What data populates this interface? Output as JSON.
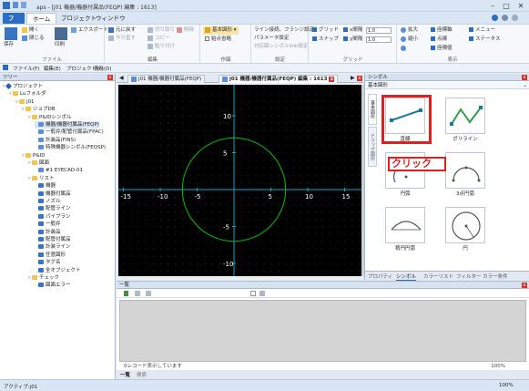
{
  "window": {
    "title": "aps - [j01 機器/機器付属品(FEQP) 編集 : 1613]",
    "min": "–",
    "max": "□",
    "close": "✕"
  },
  "tabs": {
    "file": "ファイル",
    "home": "ホーム",
    "project": "プロジェクト",
    "window": "ウィンドウ"
  },
  "ribbon": {
    "file_group": {
      "save": "保存",
      "open": "開く",
      "close": "閉じる",
      "print": "印刷",
      "export": "エクスポート",
      "label": "ファイル"
    },
    "edit_group": {
      "undo": "元に戻す",
      "redo": "やり直す",
      "cut": "切り取り",
      "delete": "削除",
      "copy": "コピー",
      "paste": "貼り付け",
      "label": "編集"
    },
    "draw_group": {
      "basic_shape": "基本図形",
      "midpoint": "始点省略",
      "label": "作図"
    },
    "settings_group": {
      "line_conn": "ライン接続、フランジ設定",
      "param": "パラメータ設定",
      "symbol_link": "対応図シンボルlink設定",
      "label": "設定"
    },
    "grid_group": {
      "grid": "グリッド",
      "snap": "スナップ",
      "x_spacing": "x間隔",
      "y_spacing": "y間隔",
      "x_value": "1.0",
      "y_value": "1.0",
      "label": "グリッド"
    },
    "view_group": {
      "zoom_in": "拡大",
      "zoom_out": "縮小",
      "coord_sys": "座標軸",
      "point": "点線",
      "coord_val": "座標値",
      "menu": "メニュー",
      "status": "ステータス",
      "label": "表示"
    }
  },
  "menubar2": {
    "file": "ファイル(F)",
    "edit": "編集(E)",
    "project": "プロジェクト(P)",
    "view": "表示(D)"
  },
  "tree": {
    "title": "ツリー",
    "nodes": [
      "プロジェクト",
      "Luフォルダ",
      "j01",
      "ジョブDB",
      "P&IDシンボル",
      "機器/機器付属品(FEQP)",
      "一般弁/配管付属品(FPAC)",
      "計装品(FINS)",
      "特殊機器シンボル(FEQSP)",
      "P&ID",
      "図面",
      "#1 EYECAD-01",
      "リスト",
      "機器",
      "機器付属品",
      "ノズル",
      "配管ライン",
      "パイプラン",
      "一般弁",
      "計装品",
      "配管付属品",
      "計装ライン",
      "任意図形",
      "タグ名",
      "全オブジェクト",
      "チェック",
      "図面エラー"
    ]
  },
  "doctabs": {
    "tab1": "j01 機器/機器付属品(FEQP)",
    "tab2": "j01 機器/機器付属品(FEQP) 編集 : 1613"
  },
  "canvas": {
    "x_ticks": [
      "-15",
      "-10",
      "-5",
      "5",
      "10",
      "15"
    ],
    "y_ticks": [
      "10",
      "5",
      "-5",
      "-10"
    ]
  },
  "symbols": {
    "title": "シンボル",
    "category": "基本図形",
    "vtab1": "基本図形",
    "vtab2": "ドラッグ図形",
    "items": [
      "直線",
      "ポリライン",
      "円弧",
      "3点円弧",
      "楕円円弧",
      "円"
    ],
    "callout": "クリック",
    "bottom_tabs": [
      "プロパティ",
      "シンボル",
      "カラーリスト",
      "フィルター",
      "カラー条件"
    ]
  },
  "list": {
    "title": "一覧",
    "footer": "0レコード表示しています",
    "zoom": "100%",
    "tabs": [
      "一覧",
      "検索"
    ]
  },
  "status": {
    "left": "アクティブ:j01",
    "zoom": "100%"
  },
  "colors": {
    "accent": "#2b6cc4",
    "highlight": "#e02020",
    "canvas_bg": "#000000",
    "axis": "#00a8e0",
    "circle": "#00c000"
  }
}
